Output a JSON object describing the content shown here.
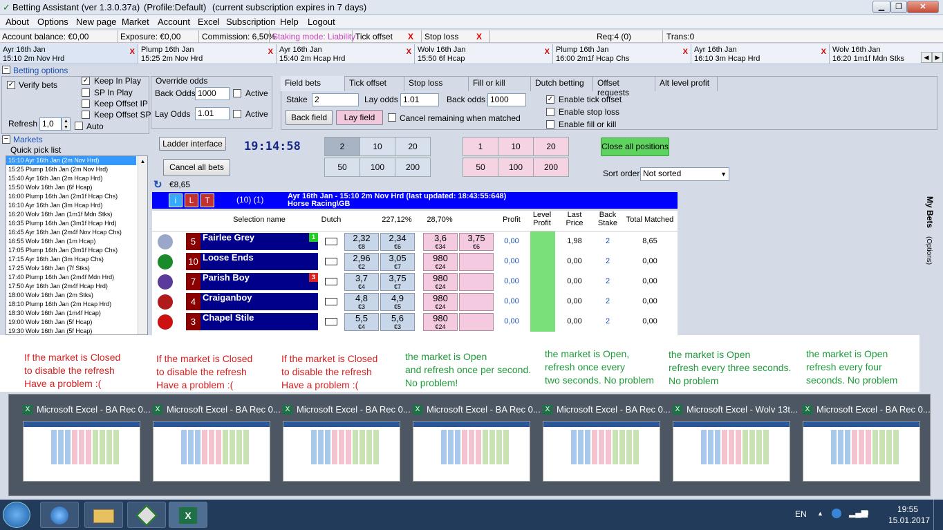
{
  "window": {
    "title": "Betting Assistant (ver 1.3.0.37a)",
    "profile": "(Profile:Default)",
    "subscription": "(current subscription expires in 7 days)"
  },
  "menu": [
    "About",
    "Options",
    "New page",
    "Market",
    "Account",
    "Excel",
    "Subscription",
    "Help",
    "Logout"
  ],
  "info": {
    "balance": "Account balance: €0,00",
    "exposure": "Exposure: €0,00",
    "commission": "Commission: 6,50%",
    "staking": "Staking mode: Liability",
    "tick_offset": "Tick offset",
    "tick_x": "X",
    "stop_loss": "Stop loss",
    "stop_x": "X",
    "req": "Req:4 (0)",
    "trans": "Trans:0"
  },
  "market_tabs": [
    {
      "l1": "Ayr 16th Jan",
      "l2": "15:10 2m Nov Hrd"
    },
    {
      "l1": "Plump 16th Jan",
      "l2": "15:25 2m Nov Hrd"
    },
    {
      "l1": "Ayr 16th Jan",
      "l2": "15:40 2m Hcap Hrd"
    },
    {
      "l1": "Wolv 16th Jan",
      "l2": "15:50 6f Hcap"
    },
    {
      "l1": "Plump 16th Jan",
      "l2": "16:00 2m1f Hcap Chs"
    },
    {
      "l1": "Ayr 16th Jan",
      "l2": "16:10 3m Hcap Hrd"
    },
    {
      "l1": "Wolv 16th Jan",
      "l2": "16:20 1m1f Mdn Stks"
    }
  ],
  "betting_options": {
    "header": "Betting options",
    "verify": "Verify bets",
    "keep_in_play": "Keep In Play",
    "sp_in_play": "SP In Play",
    "keep_offset_ip": "Keep Offset IP",
    "keep_offset_sp": "Keep Offset SP",
    "override": "Override odds",
    "back_odds_label": "Back Odds",
    "back_odds": "1000",
    "active1": "Active",
    "lay_odds_label": "Lay Odds",
    "lay_odds": "1.01",
    "active2": "Active",
    "refresh_label": "Refresh",
    "refresh": "1,0",
    "auto": "Auto"
  },
  "field_tabs": [
    "Field bets",
    "Tick offset",
    "Stop loss",
    "Fill or kill",
    "Dutch betting",
    "Offset requests",
    "Alt level profit"
  ],
  "field": {
    "stake_label": "Stake",
    "stake": "2",
    "lay_odds_label": "Lay odds",
    "lay_odds": "1.01",
    "back_odds_label": "Back odds",
    "back_odds": "1000",
    "back_field": "Back field",
    "lay_field": "Lay field",
    "cancel_remaining": "Cancel remaining when matched",
    "enable_tick": "Enable tick offset",
    "enable_stop": "Enable stop loss",
    "enable_fill": "Enable fill or kill"
  },
  "markets": {
    "header": "Markets",
    "quick": "Quick pick list",
    "items": [
      "15:10 Ayr 16th Jan (2m Nov Hrd)",
      "15:25 Plump 16th Jan (2m Nov Hrd)",
      "15:40 Ayr 16th Jan (2m Hcap Hrd)",
      "15:50 Wolv 16th Jan (6f Hcap)",
      "16:00 Plump 16th Jan (2m1f Hcap Chs)",
      "16:10 Ayr 16th Jan (3m Hcap Hrd)",
      "16:20 Wolv 16th Jan (1m1f Mdn Stks)",
      "16:35 Plump 16th Jan (3m1f Hcap Hrd)",
      "16:45 Ayr 16th Jan (2m4f Nov Hcap Chs)",
      "16:55 Wolv 16th Jan (1m Hcap)",
      "17:05 Plump 16th Jan (3m1f Hcap Chs)",
      "17:15 Ayr 16th Jan (3m Hcap Chs)",
      "17:25 Wolv 16th Jan (7f Stks)",
      "17:40 Plump 16th Jan (2m4f Mdn Hrd)",
      "17:50 Ayr 16th Jan (2m4f Hcap Hrd)",
      "18:00 Wolv 16th Jan (2m Stks)",
      "18:10 Plump 16th Jan (2m Hcap Hrd)",
      "18:30 Wolv 16th Jan (1m4f Hcap)",
      "19:00 Wolv 16th Jan (5f Hcap)",
      "19:30 Wolv 16th Jan (5f Hcap)"
    ]
  },
  "ladder": "Ladder interface",
  "cancel_all": "Cancel all bets",
  "clock": "19:14:58",
  "balance": "€8,65",
  "quick_back": [
    "2",
    "10",
    "20",
    "50",
    "100",
    "200"
  ],
  "quick_lay": [
    "1",
    "10",
    "20",
    "50",
    "100",
    "200"
  ],
  "close_all": "Close all positions",
  "sort_label": "Sort order",
  "sort_value": "Not sorted",
  "market_header": {
    "i": "i",
    "l": "L",
    "t": "T",
    "count": "(10) (1)",
    "title": "Ayr 16th Jan - 15:10 2m Nov Hrd (last updated: 18:43:55:648)",
    "sub": "Horse Racing\\GB"
  },
  "columns": {
    "selection": "Selection name",
    "dutch": "Dutch",
    "back_pct": "227,12%",
    "lay_pct": "28,70%",
    "profit": "Profit",
    "level": "Level Profit",
    "last": "Last Price",
    "backstake": "Back Stake",
    "total": "Total Matched"
  },
  "runners": [
    {
      "num": "5",
      "name": "Fairlee Grey",
      "badge": "1",
      "badge_color": "#22cc22",
      "b1": "2,32",
      "b1s": "€8",
      "b2": "2,34",
      "b2s": "€6",
      "l1": "3,6",
      "l1s": "€34",
      "l2": "3,75",
      "l2s": "€6",
      "profit": "0,00",
      "last": "1,98",
      "stake": "2",
      "total": "8,65",
      "silk": "#9aa7c8"
    },
    {
      "num": "10",
      "name": "Loose Ends",
      "badge": "",
      "badge_color": "",
      "b1": "2,96",
      "b1s": "€2",
      "b2": "3,05",
      "b2s": "€7",
      "l1": "980",
      "l1s": "€24",
      "l2": "",
      "l2s": "",
      "profit": "0,00",
      "last": "0,00",
      "stake": "2",
      "total": "0,00",
      "silk": "#1a8a2a"
    },
    {
      "num": "7",
      "name": "Parish Boy",
      "badge": "3",
      "badge_color": "#dd2222",
      "b1": "3,7",
      "b1s": "€4",
      "b2": "3,75",
      "b2s": "€7",
      "l1": "980",
      "l1s": "€24",
      "l2": "",
      "l2s": "",
      "profit": "0,00",
      "last": "0,00",
      "stake": "2",
      "total": "0,00",
      "silk": "#5a3a9a"
    },
    {
      "num": "4",
      "name": "Craiganboy",
      "badge": "",
      "badge_color": "",
      "b1": "4,8",
      "b1s": "€3",
      "b2": "4,9",
      "b2s": "€5",
      "l1": "980",
      "l1s": "€24",
      "l2": "",
      "l2s": "",
      "profit": "0,00",
      "last": "0,00",
      "stake": "2",
      "total": "0,00",
      "silk": "#b01a1a"
    },
    {
      "num": "3",
      "name": "Chapel Stile",
      "badge": "",
      "badge_color": "",
      "b1": "5,5",
      "b1s": "€4",
      "b2": "5,6",
      "b2s": "€3",
      "l1": "980",
      "l1s": "€24",
      "l2": "",
      "l2s": "",
      "profit": "0,00",
      "last": "0,00",
      "stake": "2",
      "total": "0,00",
      "silk": "#cc1111"
    }
  ],
  "side": {
    "my_bets": "My Bets",
    "options": "(Options)"
  },
  "notes": [
    {
      "text": "If the market is Closed\nto disable the refresh\nHave a problem  :(",
      "color": "#d62020"
    },
    {
      "text": "If the market is Closed\nto disable the refresh\nHave a problem  :(",
      "color": "#d62020"
    },
    {
      "text": "If the market is Closed\nto disable the refresh\nHave a problem  :(",
      "color": "#d62020"
    },
    {
      "text": "the market is Open\nand refresh once per second.\nNo problem!",
      "color": "#1f9a3a"
    },
    {
      "text": "the market is Open,\nrefresh once every\ntwo seconds. No problem",
      "color": "#1f9a3a"
    },
    {
      "text": "the market is Open\nrefresh every three seconds.\nNo problem",
      "color": "#1f9a3a"
    },
    {
      "text": "the market is Open\nrefresh every four\nseconds. No problem",
      "color": "#1f9a3a"
    }
  ],
  "previews": [
    "Microsoft Excel - BA Rec 0...",
    "Microsoft Excel - BA Rec 0...",
    "Microsoft Excel - BA Rec 0...",
    "Microsoft Excel - BA Rec 0...",
    "Microsoft Excel - BA Rec 0...",
    "Microsoft Excel - Wolv 13t...",
    "Microsoft Excel - BA Rec 0..."
  ],
  "tray": {
    "lang": "EN",
    "time": "19:55",
    "date": "15.01.2017"
  }
}
